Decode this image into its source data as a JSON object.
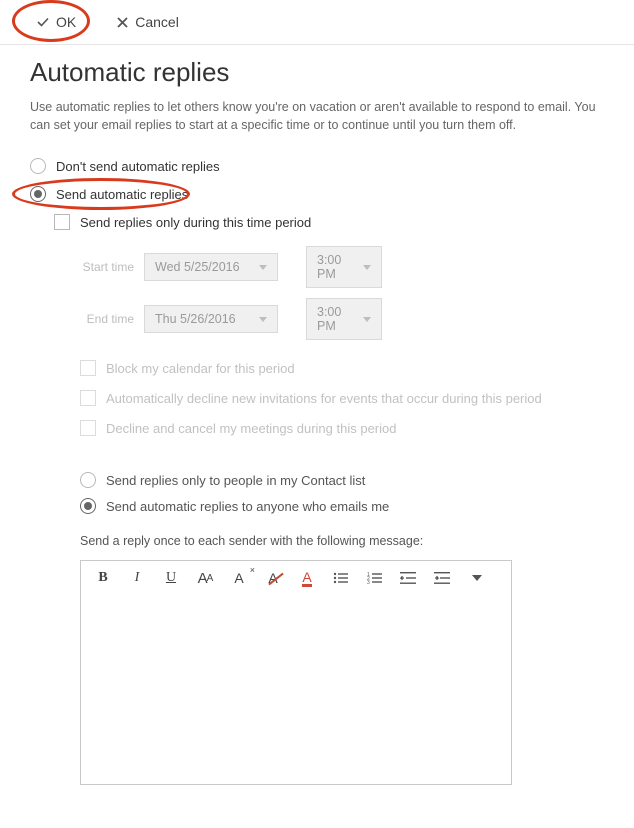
{
  "toolbar": {
    "ok_label": "OK",
    "cancel_label": "Cancel"
  },
  "page": {
    "title": "Automatic replies",
    "description": "Use automatic replies to let others know you're on vacation or aren't available to respond to email. You can set your email replies to start at a specific time or to continue until you turn them off."
  },
  "auto_reply": {
    "dont_send_label": "Don't send automatic replies",
    "send_label": "Send automatic replies",
    "time_period_label": "Send replies only during this time period",
    "start_label": "Start time",
    "end_label": "End time",
    "start_date": "Wed 5/25/2016",
    "start_time": "3:00 PM",
    "end_date": "Thu 5/26/2016",
    "end_time": "3:00 PM",
    "block_calendar_label": "Block my calendar for this period",
    "decline_new_label": "Automatically decline new invitations for events that occur during this period",
    "decline_cancel_label": "Decline and cancel my meetings during this period"
  },
  "recipients": {
    "contacts_only_label": "Send replies only to people in my Contact list",
    "anyone_label": "Send automatic replies to anyone who emails me"
  },
  "message": {
    "prompt": "Send a reply once to each sender with the following message:"
  },
  "icons": {
    "check": "check-icon",
    "close": "close-icon",
    "chevron_down": "chevron-down-icon"
  }
}
